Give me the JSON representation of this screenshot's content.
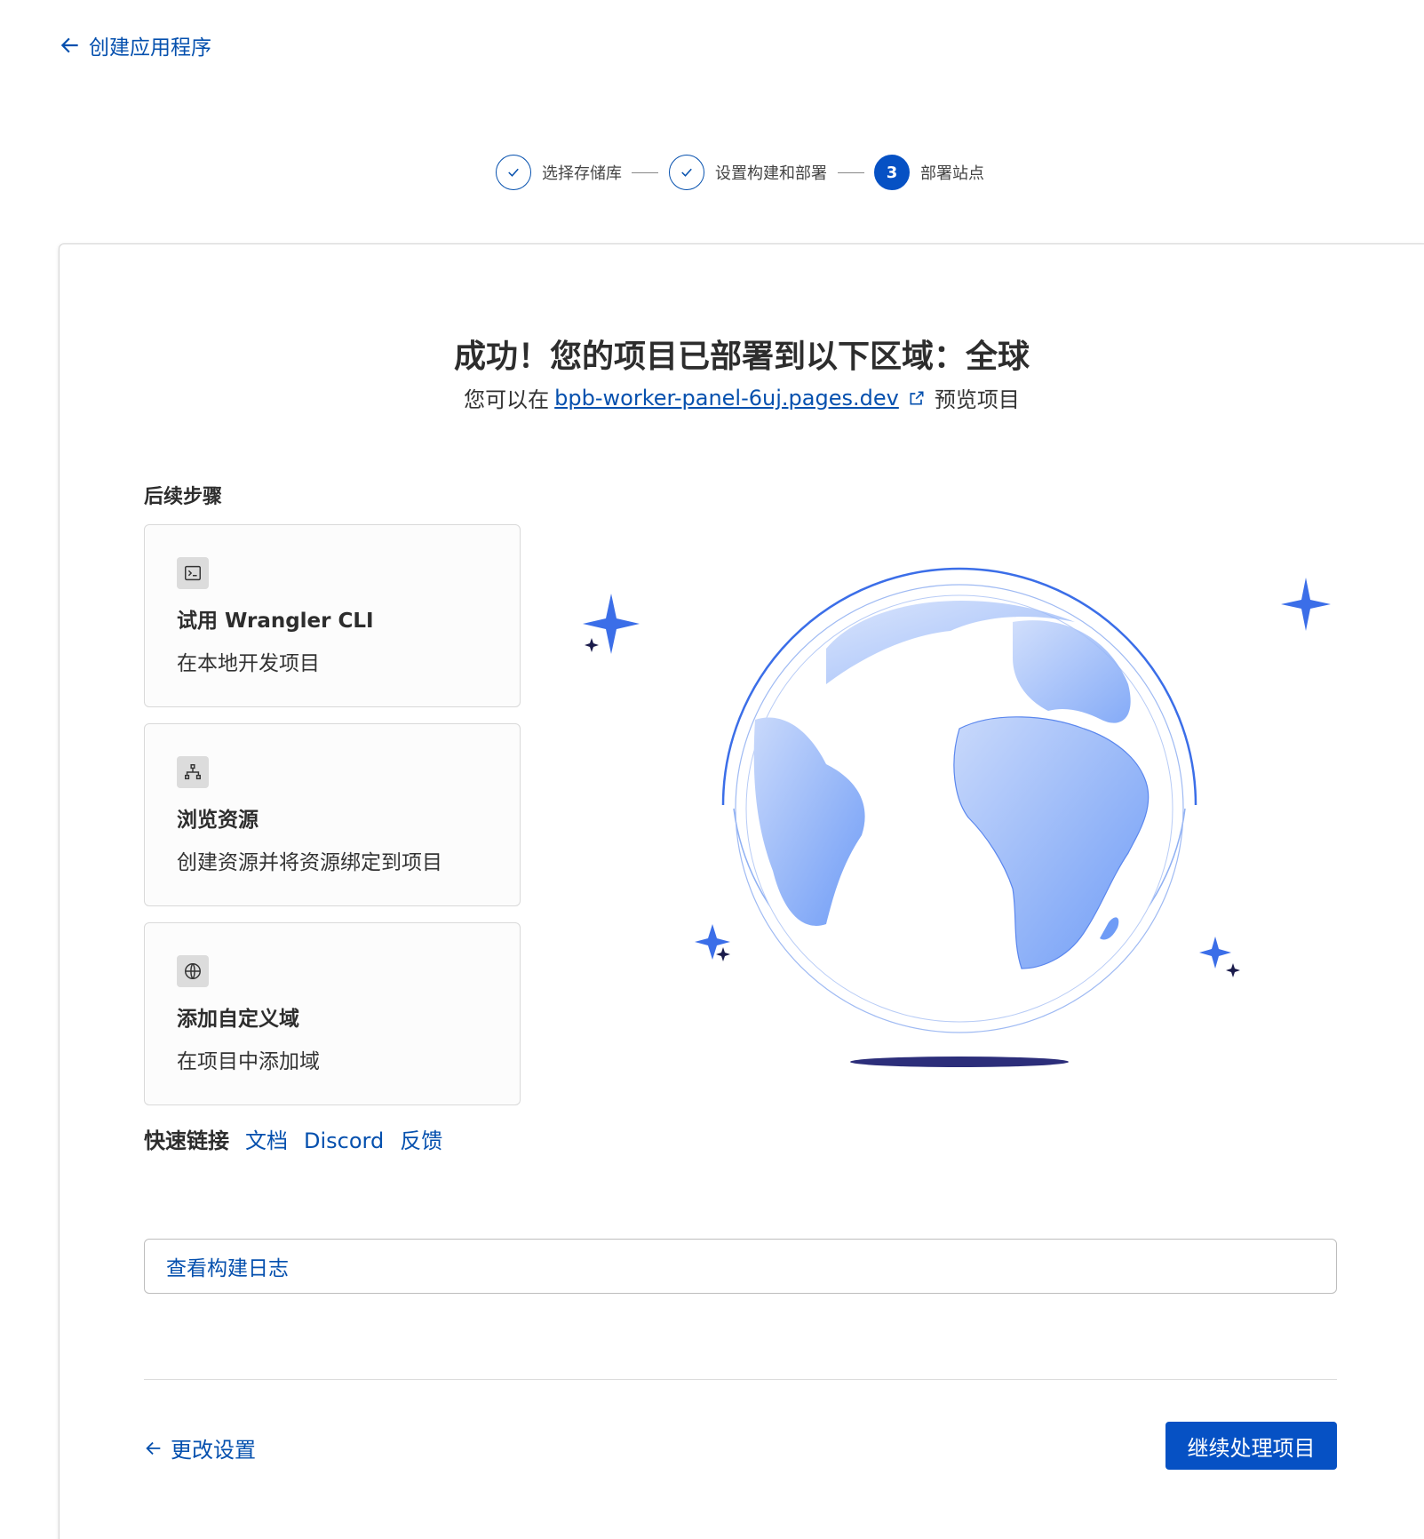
{
  "back_link": {
    "label": "创建应用程序"
  },
  "stepper": {
    "steps": [
      {
        "label": "选择存储库",
        "state": "done"
      },
      {
        "label": "设置构建和部署",
        "state": "done"
      },
      {
        "label": "部署站点",
        "state": "active",
        "number": "3"
      }
    ]
  },
  "result": {
    "headline": "成功！您的项目已部署到以下区域：全球",
    "sub_prefix": "您可以在",
    "url": "bpb-worker-panel-6uj.pages.dev",
    "sub_suffix": "预览项目"
  },
  "next_steps": {
    "title": "后续步骤",
    "cards": [
      {
        "icon": "terminal-icon",
        "title": "试用 Wrangler CLI",
        "desc": "在本地开发项目"
      },
      {
        "icon": "sitemap-icon",
        "title": "浏览资源",
        "desc": "创建资源并将资源绑定到项目"
      },
      {
        "icon": "globe-icon",
        "title": "添加自定义域",
        "desc": "在项目中添加域"
      }
    ]
  },
  "quick_links": {
    "label": "快速链接",
    "links": [
      "文档",
      "Discord",
      "反馈"
    ]
  },
  "build_log": {
    "label": "查看构建日志"
  },
  "footer": {
    "back_label": "更改设置",
    "primary_label": "继续处理项目"
  },
  "colors": {
    "accent": "#0550ae",
    "primary_button": "#0651c4",
    "globe_blue": "#6f9cf6",
    "sparkle": "#3b6ee8",
    "shadow": "#2c2e7a"
  }
}
